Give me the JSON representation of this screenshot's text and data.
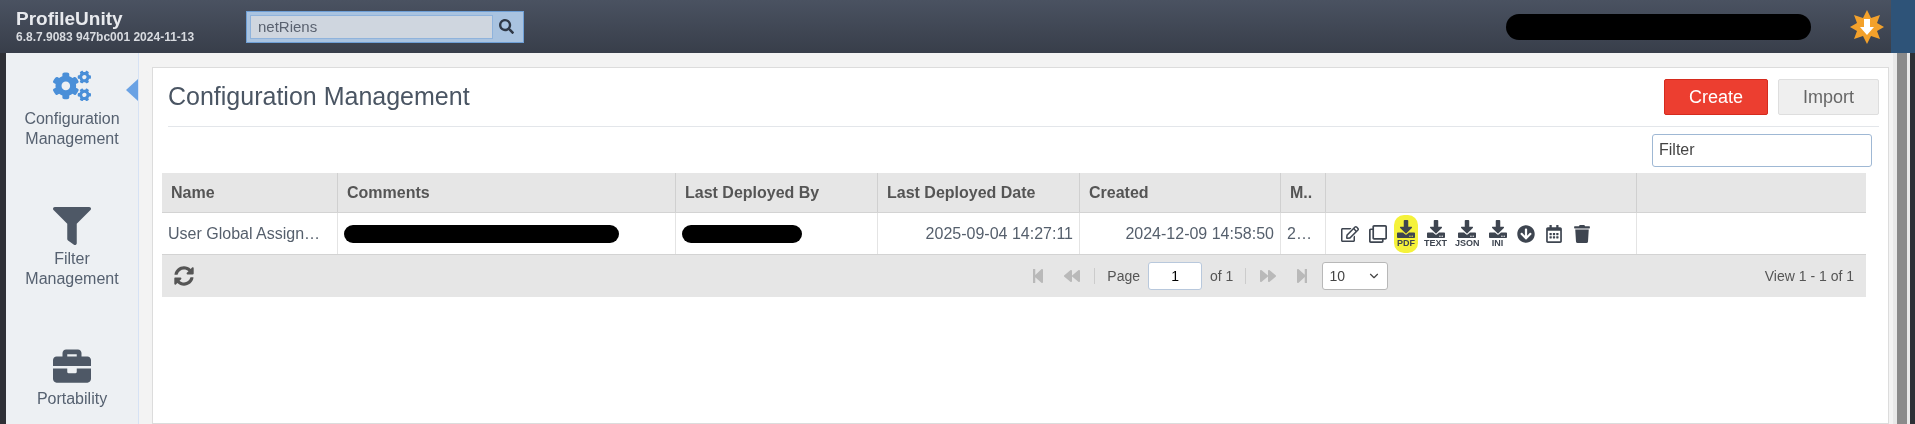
{
  "app": {
    "title": "ProfileUnity",
    "version": "6.8.7.9083 947bc001 2024-11-13"
  },
  "search": {
    "value": "netRiens"
  },
  "user": {
    "kind": "redacted"
  },
  "sidebar": {
    "items": [
      {
        "label": "Configuration Management",
        "selected": true
      },
      {
        "label": "Filter Management",
        "selected": false
      },
      {
        "label": "Portability",
        "selected": false
      }
    ]
  },
  "page": {
    "title": "Configuration Management",
    "buttons": [
      {
        "label": "Create",
        "kind": "primary"
      },
      {
        "label": "Import",
        "kind": "secondary"
      }
    ]
  },
  "filter": {
    "placeholder": "Filter"
  },
  "table": {
    "columns": [
      "Name",
      "Comments",
      "Last Deployed By",
      "Last Deployed Date",
      "Created",
      "M..",
      ""
    ],
    "rows": [
      {
        "cells": [
          {
            "kind": "text",
            "text": "User Global Assign…"
          },
          {
            "kind": "redacted"
          },
          {
            "kind": "redacted"
          },
          {
            "kind": "text",
            "text": "2025-09-04 14:27:11"
          },
          {
            "kind": "text",
            "text": "2024-12-09 14:58:50"
          },
          {
            "kind": "text",
            "text": "2…"
          }
        ],
        "actions": [
          {
            "kind": "edit",
            "highlighted": false
          },
          {
            "kind": "copy",
            "highlighted": false
          },
          {
            "kind": "download",
            "label": "PDF",
            "highlighted": true
          },
          {
            "kind": "download",
            "label": "TEXT",
            "highlighted": false
          },
          {
            "kind": "download",
            "label": "JSON",
            "highlighted": false
          },
          {
            "kind": "download",
            "label": "INI",
            "highlighted": false
          },
          {
            "kind": "deploy",
            "highlighted": false
          },
          {
            "kind": "schedule",
            "highlighted": false
          },
          {
            "kind": "delete",
            "highlighted": false
          }
        ]
      }
    ]
  },
  "pager": {
    "page_label": "Page",
    "page": "1",
    "of": "of 1",
    "page_size": "10",
    "summary": "View 1 - 1 of 1"
  }
}
